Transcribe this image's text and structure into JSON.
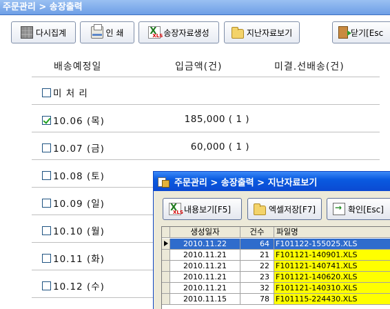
{
  "window": {
    "title": "주문관리 > 송장출력"
  },
  "toolbar": {
    "refresh_label": "다시집계",
    "print_label": "인 쇄",
    "create_label": "송장자료생성",
    "past_label": "지난자료보기",
    "close_label": "닫기[Esc"
  },
  "columns": {
    "date": "배송예정일",
    "amount": "입금액(건)",
    "unsettled": "미결.선배송(건)"
  },
  "rows": [
    {
      "label": "미 처 리",
      "checked": false,
      "amount": ""
    },
    {
      "label": "10.06 (목)",
      "checked": true,
      "amount": "185,000 (   1 )"
    },
    {
      "label": "10.07 (금)",
      "checked": false,
      "amount": "60,000 (   1 )"
    },
    {
      "label": "10.08 (토)",
      "checked": false,
      "amount": ""
    },
    {
      "label": "10.09 (일)",
      "checked": false,
      "amount": ""
    },
    {
      "label": "10.10 (월)",
      "checked": false,
      "amount": ""
    },
    {
      "label": "10.11 (화)",
      "checked": false,
      "amount": ""
    },
    {
      "label": "10.12 (수)",
      "checked": false,
      "amount": ""
    }
  ],
  "subwindow": {
    "title": "주문관리 > 송장출력 > 지난자료보기",
    "view_label": "내용보기[F5]",
    "excel_label": "엑셀저장[F7]",
    "ok_label": "확인[Esc]",
    "grid": {
      "headers": {
        "date": "생성일자",
        "count": "건수",
        "file": "파일명"
      },
      "rows": [
        {
          "date": "2010.11.22",
          "count": "64",
          "file": "F101122-155025.XLS",
          "selected": true
        },
        {
          "date": "2010.11.21",
          "count": "21",
          "file": "F101121-140901.XLS",
          "selected": false
        },
        {
          "date": "2010.11.21",
          "count": "22",
          "file": "F101121-140741.XLS",
          "selected": false
        },
        {
          "date": "2010.11.21",
          "count": "23",
          "file": "F101121-140620.XLS",
          "selected": false
        },
        {
          "date": "2010.11.21",
          "count": "32",
          "file": "F101121-140310.XLS",
          "selected": false
        },
        {
          "date": "2010.11.15",
          "count": "78",
          "file": "F101115-224430.XLS",
          "selected": false
        }
      ]
    }
  },
  "colors": {
    "title_bar": "#6e9fe6",
    "sub_title_bar": "#0a5ae0",
    "selection": "#2f6ccc",
    "highlight": "#ffff00"
  }
}
